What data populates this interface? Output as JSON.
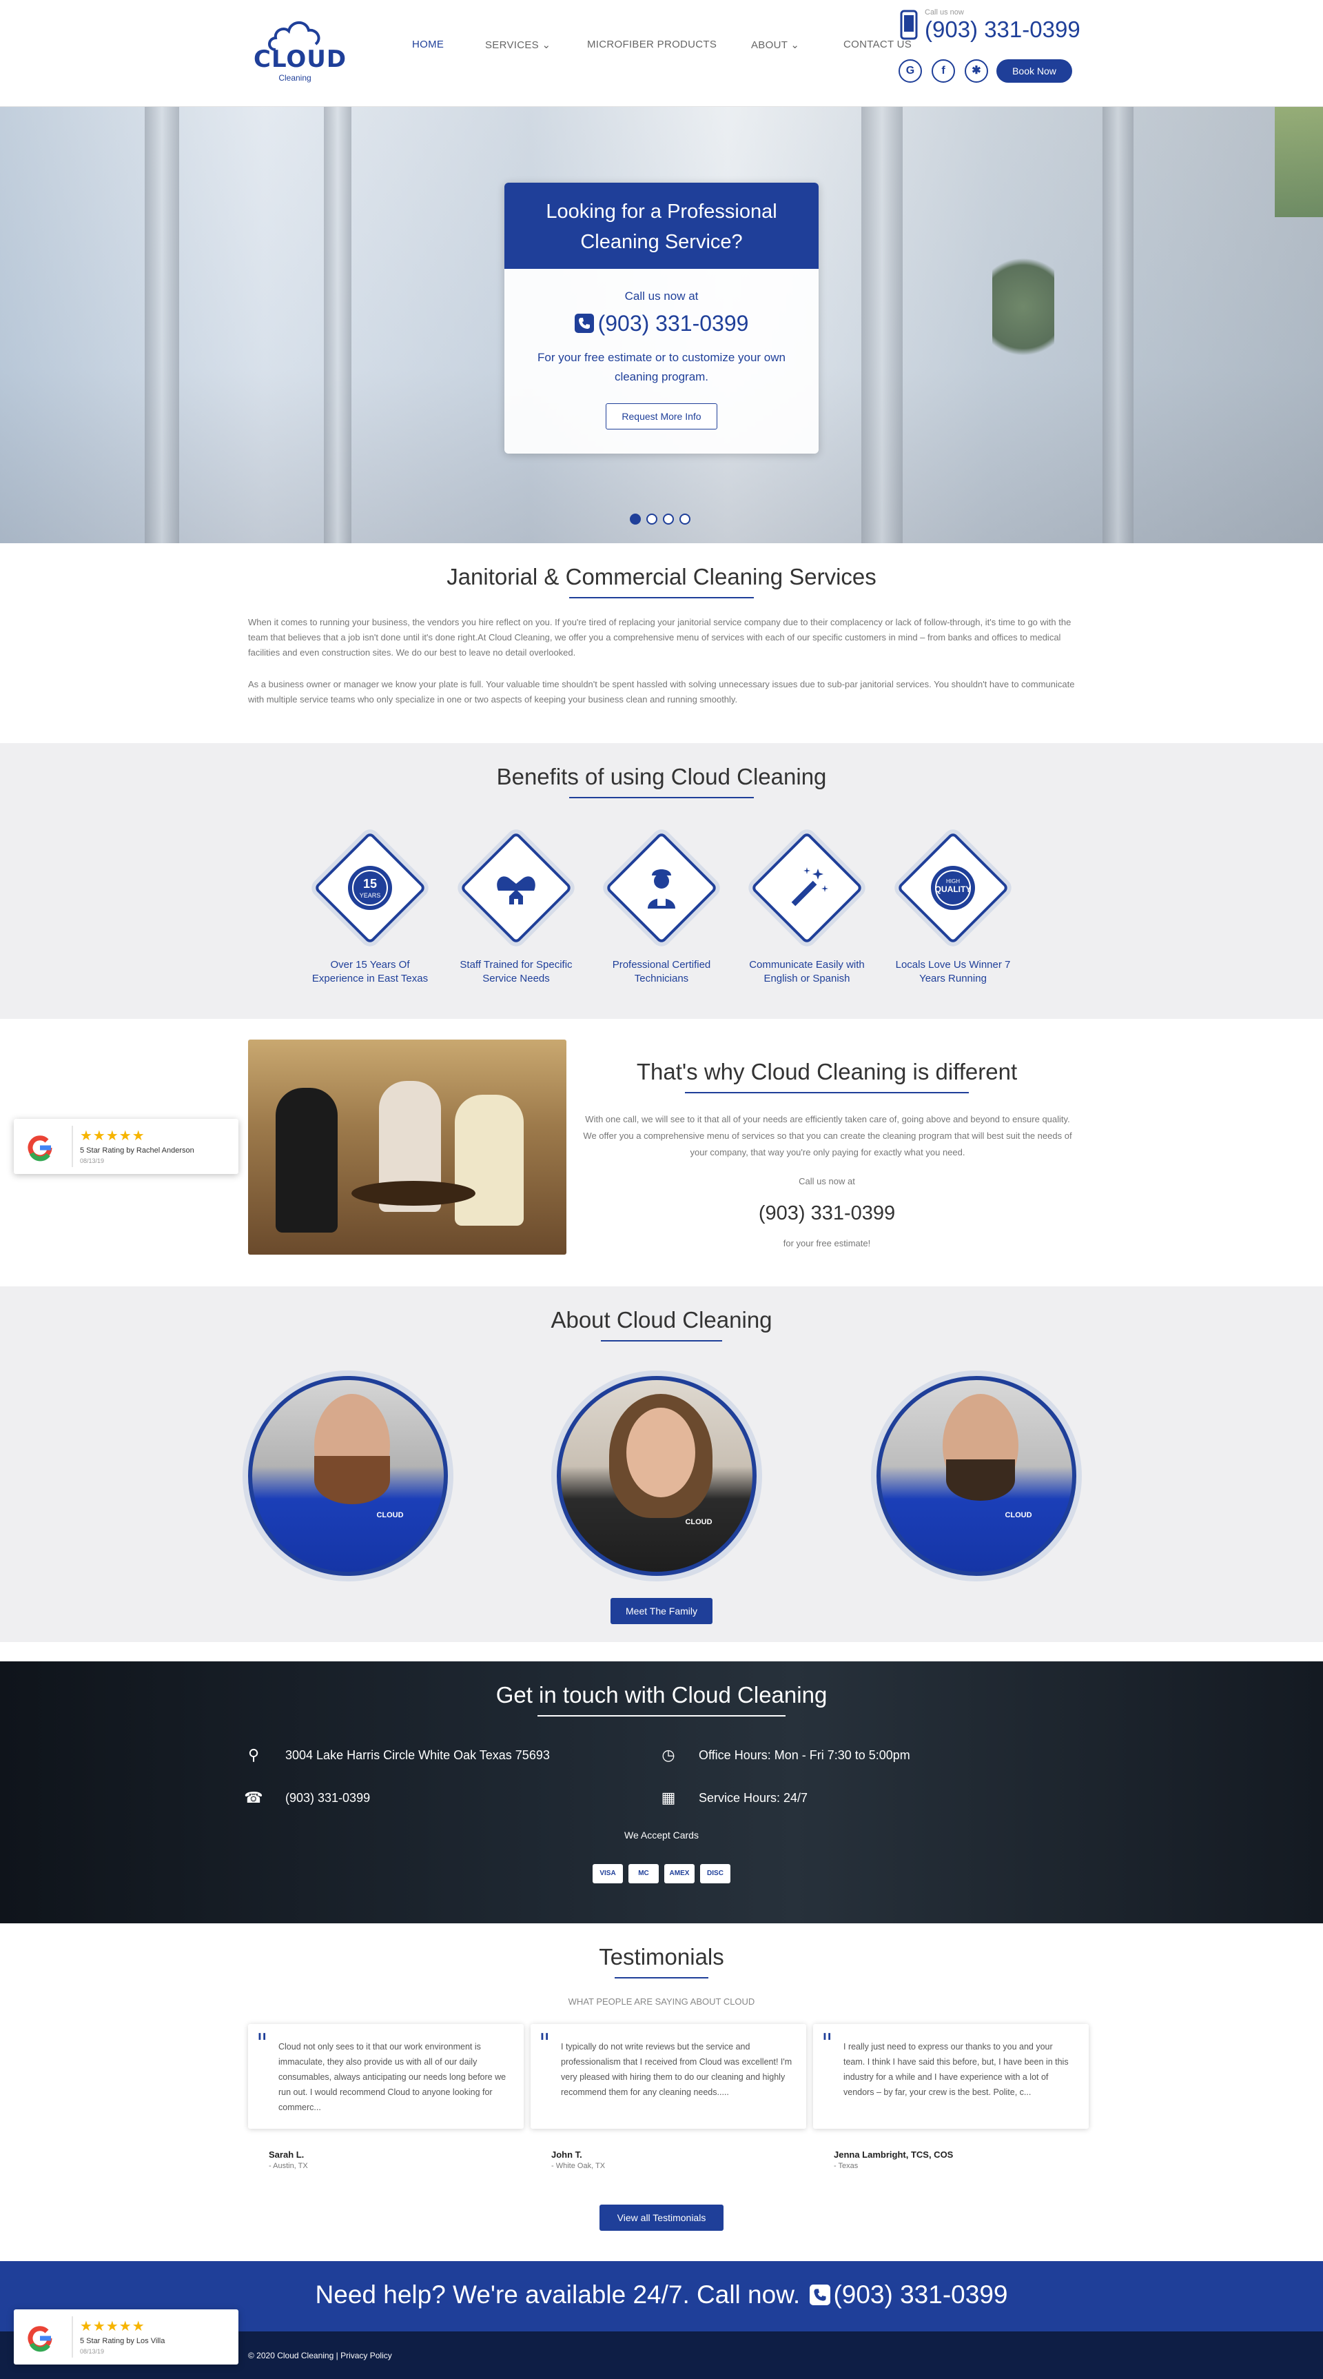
{
  "colors": {
    "brand": "#1f3f99",
    "star": "#f6b400",
    "footer": "#0e1e45"
  },
  "header": {
    "logo_text": "CLOUD",
    "logo_sub": "Cleaning",
    "nav": [
      {
        "label": "HOME",
        "active": true
      },
      {
        "label": "SERVICES ⌄"
      },
      {
        "label": "MICROFIBER PRODUCTS"
      },
      {
        "label": "ABOUT ⌄"
      },
      {
        "label": "CONTACT US"
      }
    ],
    "call_label": "Call us now",
    "phone": "(903) 331-0399",
    "social_icons": [
      "google-icon",
      "facebook-icon",
      "yelp-icon"
    ],
    "book_now": "Book Now"
  },
  "hero": {
    "title": "Looking for a Professional Cleaning Service?",
    "call_label": "Call us now at",
    "phone": "(903) 331-0399",
    "text": "For your free estimate or to customize your own cleaning program.",
    "button": "Request More Info",
    "slides": 4,
    "active_slide": 1
  },
  "janitorial": {
    "title": "Janitorial & Commercial Cleaning Services",
    "p1": "When it comes to running your business, the vendors you hire reflect on you. If you're tired of replacing your janitorial service company due to their complacency or lack of follow-through, it's time to go with the team that believes that a job isn't done until it's done right.At Cloud Cleaning, we offer you a comprehensive menu of services with each of our specific customers in mind – from banks and offices to medical facilities and even construction sites. We do our best to leave no detail overlooked.",
    "p2": "As a business owner or manager we know your plate is full. Your valuable time shouldn't be spent hassled with solving unnecessary issues due to sub-par janitorial services. You shouldn't have to communicate with multiple service teams who only specialize in one or two aspects of keeping your business clean and running smoothly."
  },
  "benefits": {
    "title": "Benefits of using Cloud Cleaning",
    "items": [
      {
        "label": "Over 15 Years Of Experience in East Texas",
        "icon": "years-badge-icon",
        "badge": "15",
        "badge_sub": "YEARS"
      },
      {
        "label": "Staff Trained for Specific Service Needs",
        "icon": "home-hands-icon"
      },
      {
        "label": "Professional Certified Technicians",
        "icon": "technician-icon"
      },
      {
        "label": "Communicate Easily with English or Spanish",
        "icon": "magic-wand-icon"
      },
      {
        "label": "Locals Love Us Winner 7 Years Running",
        "icon": "quality-badge-icon",
        "badge": "QUALITY",
        "badge_top": "HIGH"
      }
    ]
  },
  "different": {
    "title": "That's why Cloud Cleaning is different",
    "text": "With one call, we will see to it that all of your needs are efficiently taken care of, going above and beyond to ensure quality. We offer you a comprehensive menu of services so that you can create the cleaning program that will best suit the needs of your company, that way you're only paying for exactly what you need.",
    "call_label": "Call us now at",
    "phone": "(903) 331-0399",
    "estimate": "for your free estimate!"
  },
  "about": {
    "title": "About Cloud Cleaning",
    "button": "Meet The Family",
    "shirt_logo": "CLOUD"
  },
  "contact": {
    "title": "Get in touch with Cloud Cleaning",
    "address": "3004 Lake Harris Circle White Oak Texas 75693",
    "office_hours": "Office Hours: Mon - Fri 7:30 to 5:00pm",
    "phone": "(903) 331-0399",
    "service_hours": "Service Hours: 24/7",
    "cards_label": "We Accept Cards",
    "cards": [
      "VISA",
      "MC",
      "AMEX",
      "DISC"
    ]
  },
  "testimonials": {
    "title": "Testimonials",
    "subtitle": "WHAT PEOPLE ARE SAYING ABOUT CLOUD",
    "items": [
      {
        "text": "Cloud not only sees to it that our work environment is immaculate, they also provide us with all of our daily consumables, always anticipating our needs long before we run out. I would recommend Cloud to anyone looking for commerc...",
        "name": "Sarah L.",
        "loc": "- Austin, TX"
      },
      {
        "text": "I typically do not write reviews but the service and professionalism that I received from Cloud was excellent! I'm very pleased with hiring them to do our cleaning and highly recommend them for any cleaning needs.....",
        "name": "John T.",
        "loc": "- White Oak, TX"
      },
      {
        "text": "I really just need to express our thanks to you and your team. I think I have said this before, but, I have been in this industry for a while and I have experience with a lot of vendors – by far, your crew is the best. Polite, c...",
        "name": "Jenna Lambright, TCS, COS",
        "loc": "- Texas"
      }
    ],
    "button": "View all Testimonials"
  },
  "cta": {
    "text": "Need help? We're available 24/7. Call now.",
    "phone": "(903) 331-0399"
  },
  "footer": {
    "copyright": "© 2020 Cloud Cleaning",
    "sep": "|",
    "privacy": "Privacy Policy"
  },
  "google_badges": [
    {
      "stars": "★★★★★",
      "rating": "5 Star Rating by Rachel Anderson",
      "date": "08/13/19"
    },
    {
      "stars": "★★★★★",
      "rating": "5 Star Rating by Los Villa",
      "date": "08/13/19"
    }
  ]
}
